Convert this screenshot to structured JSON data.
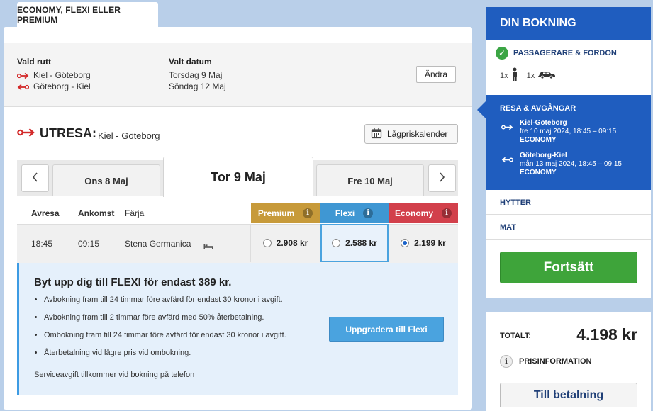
{
  "top_tab": {
    "label": "ECONOMY, FLEXI ELLER PREMIUM"
  },
  "route": {
    "route_label": "Vald rutt",
    "out_route": "Kiel - Göteborg",
    "ret_route": "Göteborg - Kiel",
    "date_label": "Valt datum",
    "out_date": "Torsdag 9 Maj",
    "ret_date": "Söndag 12 Maj",
    "change_label": "Ändra"
  },
  "utresa": {
    "title": "UTRESA:",
    "subtitle": "Kiel - Göteborg",
    "calendar_label": "Lågpriskalender"
  },
  "dates": {
    "prev": "Ons 8 Maj",
    "active": "Tor 9 Maj",
    "next": "Fre 10 Maj"
  },
  "table": {
    "headers": {
      "avresa": "Avresa",
      "ankomst": "Ankomst",
      "farja": "Färja"
    },
    "fares": [
      {
        "name": "Premium",
        "color": "#c79a3a",
        "price": "2.908 kr",
        "selected": false
      },
      {
        "name": "Flexi",
        "color": "#3f97d3",
        "price": "2.588 kr",
        "selected": false
      },
      {
        "name": "Economy",
        "color": "#d2404b",
        "price": "2.199 kr",
        "selected": true
      }
    ],
    "row": {
      "avresa": "18:45",
      "ankomst": "09:15",
      "farja": "Stena Germanica"
    }
  },
  "upgrade": {
    "title": "Byt upp dig till FLEXI för endast 389 kr.",
    "bullets": [
      "Avbokning fram till 24 timmar före avfärd för endast 30 kronor i avgift.",
      "Avbokning fram till 2 timmar före avfärd med 50% återbetalning.",
      "Ombokning fram till 24 timmar före avfärd för endast 30 kronor i avgift.",
      "Återbetalning vid lägre pris vid ombokning."
    ],
    "service_note": "Serviceavgift tillkommer vid bokning på telefon",
    "button": "Uppgradera till Flexi"
  },
  "booking": {
    "title": "DIN BOKNING",
    "passengers_label": "PASSAGERARE & FORDON",
    "person_count": "1x",
    "vehicle_count": "1x",
    "trips_label": "RESA & AVGÅNGAR",
    "legs": [
      {
        "route": "Kiel-Göteborg",
        "when": "fre 10 maj 2024, 18:45 – 09:15",
        "class": "ECONOMY"
      },
      {
        "route": "Göteborg-Kiel",
        "when": "mån 13 maj 2024, 18:45 – 09:15",
        "class": "ECONOMY"
      }
    ],
    "cabins_label": "HYTTER",
    "food_label": "MAT",
    "continue_label": "Fortsätt"
  },
  "total": {
    "label": "TOTALT:",
    "value": "4.198 kr",
    "price_info": "PRISINFORMATION",
    "pay_label": "Till betalning"
  }
}
